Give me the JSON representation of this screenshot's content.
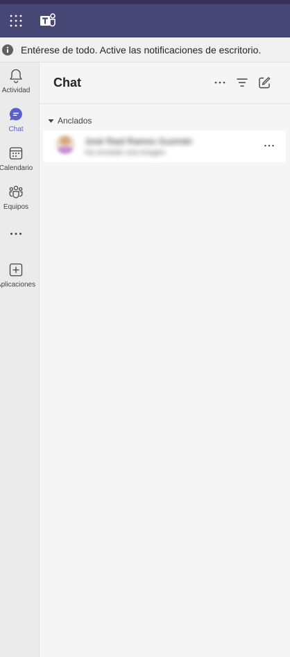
{
  "notification": {
    "text": "Entérese de todo. Active las notificaciones de escritorio."
  },
  "rail": {
    "items": [
      {
        "label": "Actividad"
      },
      {
        "label": "Chat"
      },
      {
        "label": "Calendario"
      },
      {
        "label": "Equipos"
      },
      {
        "label": ""
      },
      {
        "label": "Aplicaciones"
      }
    ]
  },
  "chat_panel": {
    "title": "Chat",
    "pinned_section": {
      "label": "Anclados"
    },
    "pinned_chats": [
      {
        "name": "José Raúl Ramos Guzmán",
        "preview": "Ha enviado una imagen"
      }
    ]
  },
  "colors": {
    "app_bar": "#464775",
    "accent": "#5b5fc7",
    "rail_bg": "#ebebeb",
    "panel_bg": "#f5f5f5"
  }
}
